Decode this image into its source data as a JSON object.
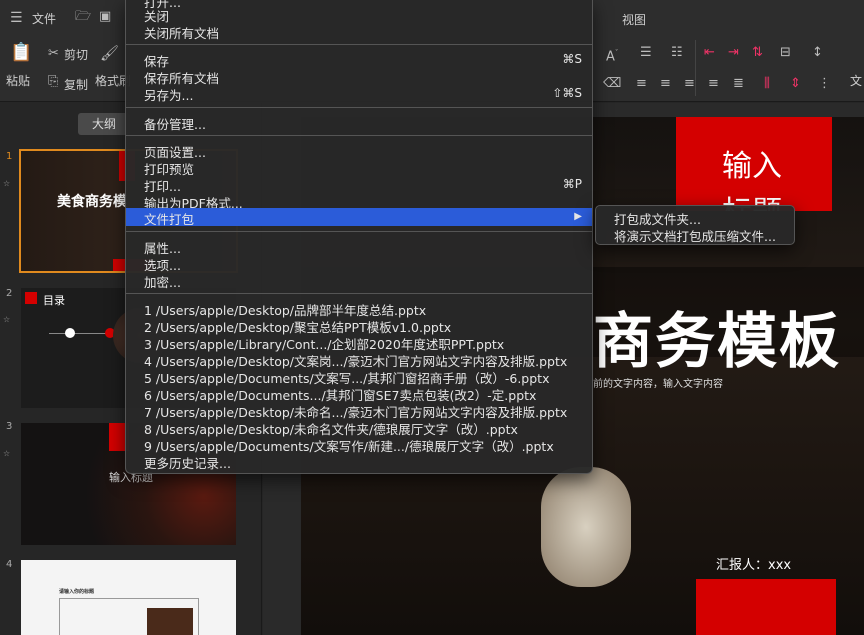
{
  "ribbon": {
    "file_label": "文件",
    "view_label": "视图",
    "cut_label": "剪切",
    "paste_label": "粘贴",
    "copy_label": "复制",
    "format_label": "格式刷",
    "right_cut_label": "文"
  },
  "left_panel": {
    "outline_tab": "大纲",
    "slides": [
      {
        "number": "1",
        "title": "美食商务模"
      },
      {
        "number": "2",
        "title": "目录"
      },
      {
        "number": "3",
        "title": "输入标题"
      },
      {
        "number": "4",
        "title": "请输入你的标题"
      }
    ]
  },
  "slide": {
    "title_box_line1": "输入",
    "title_box_line2": "标题",
    "main_title": "商务模板",
    "subtitle": "前的文字内容，输入文字内容",
    "reporter": "汇报人：xxx"
  },
  "menu": {
    "top_partial": "打开...",
    "items": [
      {
        "label": "关闭",
        "shortcut": ""
      },
      {
        "label": "关闭所有文档",
        "shortcut": ""
      },
      {
        "label": "保存",
        "shortcut": "⌘S"
      },
      {
        "label": "保存所有文档",
        "shortcut": ""
      },
      {
        "label": "另存为...",
        "shortcut": "⇧⌘S"
      },
      {
        "label": "备份管理...",
        "shortcut": ""
      },
      {
        "label": "页面设置...",
        "shortcut": ""
      },
      {
        "label": "打印预览",
        "shortcut": ""
      },
      {
        "label": "打印...",
        "shortcut": "⌘P"
      },
      {
        "label": "输出为PDF格式...",
        "shortcut": ""
      },
      {
        "label": "文件打包",
        "shortcut": "▶"
      },
      {
        "label": "属性...",
        "shortcut": ""
      },
      {
        "label": "选项...",
        "shortcut": ""
      },
      {
        "label": "加密...",
        "shortcut": ""
      }
    ],
    "recent": [
      "1 /Users/apple/Desktop/品牌部半年度总结.pptx",
      "2 /Users/apple/Desktop/聚宝总结PPT模板v1.0.pptx",
      "3 /Users/apple/Library/Cont.../企划部2020年度述职PPT.pptx",
      "4 /Users/apple/Desktop/文案岗.../豪迈木门官方网站文字内容及排版.pptx",
      "5 /Users/apple/Documents/文案写.../其邦门窗招商手册（改）-6.pptx",
      "6 /Users/apple/Documents.../其邦门窗SE7卖点包装(改2）-定.pptx",
      "7 /Users/apple/Desktop/未命名.../豪迈木门官方网站文字内容及排版.pptx",
      "8 /Users/apple/Desktop/未命名文件夹/德琅展厅文字（改）.pptx",
      "9 /Users/apple/Documents/文案写作/新建.../德琅展厅文字（改）.pptx"
    ],
    "more_history": "更多历史记录...",
    "submenu": [
      "打包成文件夹...",
      "将演示文档打包成压缩文件..."
    ]
  },
  "colors": {
    "highlight": "#2b5cd9",
    "accent": "#e08a1e",
    "brand_red": "#d40000"
  }
}
